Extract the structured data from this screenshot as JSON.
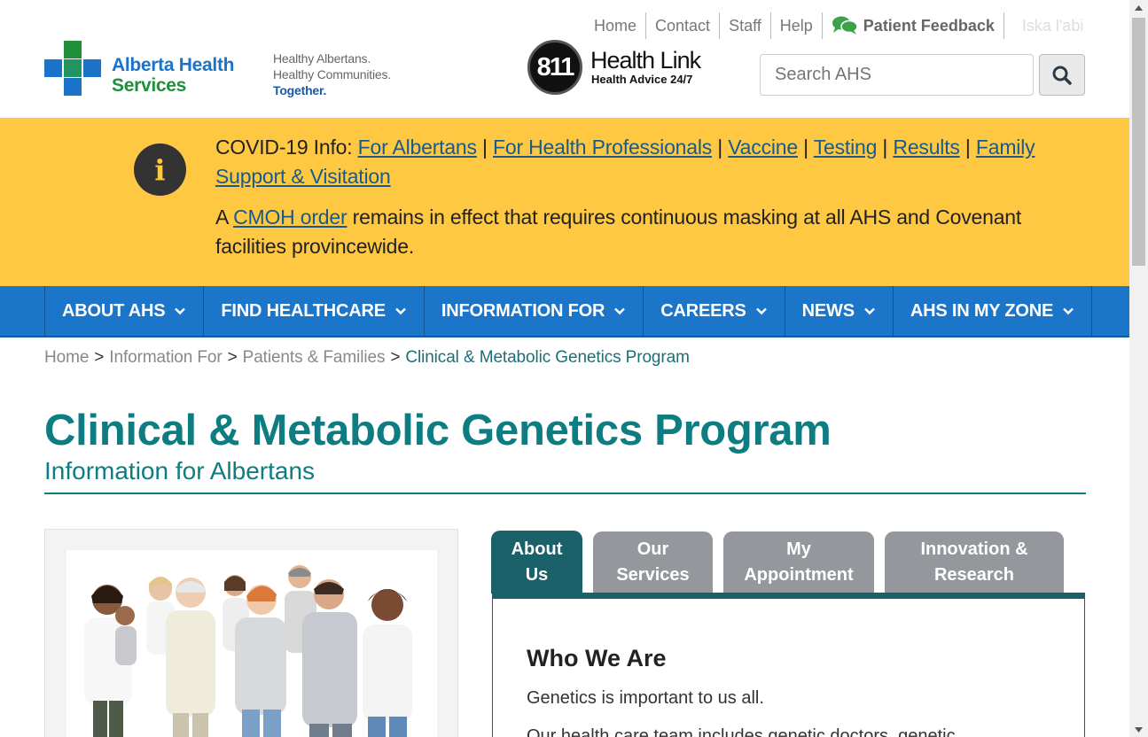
{
  "header": {
    "logo": {
      "line1": "Alberta Health",
      "line2": "Services"
    },
    "tagline": {
      "line1": "Healthy Albertans.",
      "line2": "Healthy Communities.",
      "line3": "Together."
    },
    "healthlink": {
      "number": "811",
      "title": "Health Link",
      "subtitle": "Health Advice 24/7"
    },
    "utility_links": [
      "Home",
      "Contact",
      "Staff",
      "Help"
    ],
    "feedback_label": "Patient Feedback",
    "language_label": "Iska l'abi",
    "search": {
      "placeholder": "Search AHS"
    }
  },
  "alert": {
    "prefix": "COVID-19 Info:",
    "links": [
      "For Albertans",
      "For Health Professionals",
      "Vaccine",
      "Testing",
      "Results",
      "Family Support & Visitation"
    ],
    "separator": "|",
    "notice_before": "A",
    "notice_link": "CMOH order",
    "notice_after": "remains in effect that requires continuous masking at all AHS and Covenant facilities provincewide."
  },
  "nav": {
    "items": [
      "ABOUT AHS",
      "FIND HEALTHCARE",
      "INFORMATION FOR",
      "CAREERS",
      "NEWS",
      "AHS IN MY ZONE"
    ]
  },
  "breadcrumb": {
    "items": [
      "Home",
      "Information For",
      "Patients & Families"
    ],
    "current": "Clinical & Metabolic Genetics Program",
    "separator": ">"
  },
  "page": {
    "title": "Clinical & Metabolic Genetics Program",
    "subtitle": "Information for Albertans"
  },
  "tabs": [
    {
      "line1": "About",
      "line2": "Us"
    },
    {
      "line1": "Our",
      "line2": "Services"
    },
    {
      "line1": "My",
      "line2": "Appointment"
    },
    {
      "line1": "Innovation &",
      "line2": "Research"
    }
  ],
  "panel": {
    "heading": "Who We Are",
    "paragraph1": "Genetics is important to us all.",
    "paragraph2": "Our health care team includes genetic doctors, genetic"
  },
  "colors": {
    "brand_blue": "#1b75c9",
    "alert_yellow": "#fec843",
    "title_teal": "#0d7d82",
    "tab_active": "#1b6169",
    "tab_inactive": "#94979b"
  }
}
